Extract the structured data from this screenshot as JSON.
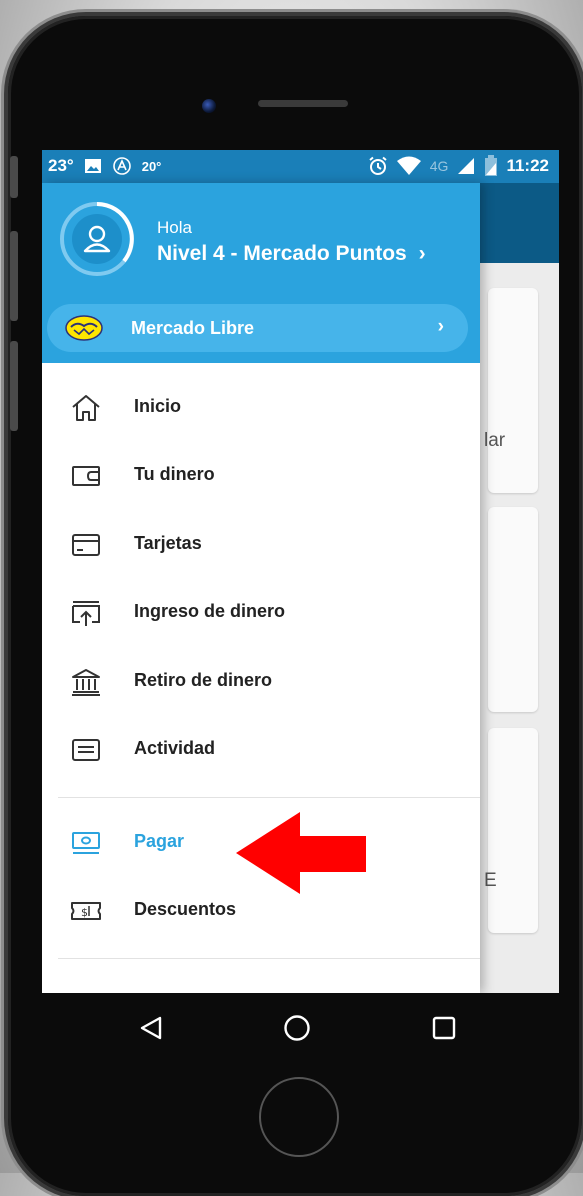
{
  "status_bar": {
    "temperature": "23°",
    "small_temp": "20°",
    "network": "4G",
    "time": "11:22",
    "icons": [
      "image-icon",
      "a-circle-icon",
      "alarm-icon",
      "wifi-icon",
      "signal-icon",
      "battery-icon"
    ]
  },
  "drawer": {
    "greeting": "Hola",
    "level": "Nivel 4 - Mercado Puntos",
    "level_chevron": "›",
    "mercadolibre_label": "Mercado Libre",
    "mercadolibre_chevron": "›",
    "items": [
      {
        "label": "Inicio",
        "icon": "home-icon"
      },
      {
        "label": "Tu dinero",
        "icon": "wallet-icon"
      },
      {
        "label": "Tarjetas",
        "icon": "card-icon"
      },
      {
        "label": "Ingreso de dinero",
        "icon": "deposit-icon"
      },
      {
        "label": "Retiro de dinero",
        "icon": "bank-icon"
      },
      {
        "label": "Actividad",
        "icon": "activity-icon"
      },
      {
        "label": "Pagar",
        "icon": "pay-icon",
        "active": true
      },
      {
        "label": "Descuentos",
        "icon": "discount-ticket-icon"
      }
    ]
  },
  "background": {
    "partial_text_1": "lar",
    "partial_text_2": "E"
  },
  "colors": {
    "accent": "#2ba3de",
    "status_bar": "#1a7fb8",
    "header_dark": "#0c5a86",
    "annotation_arrow": "#ff0000"
  },
  "navigation": {
    "buttons": [
      "back-icon",
      "home-circle-icon",
      "recents-square-icon"
    ]
  }
}
